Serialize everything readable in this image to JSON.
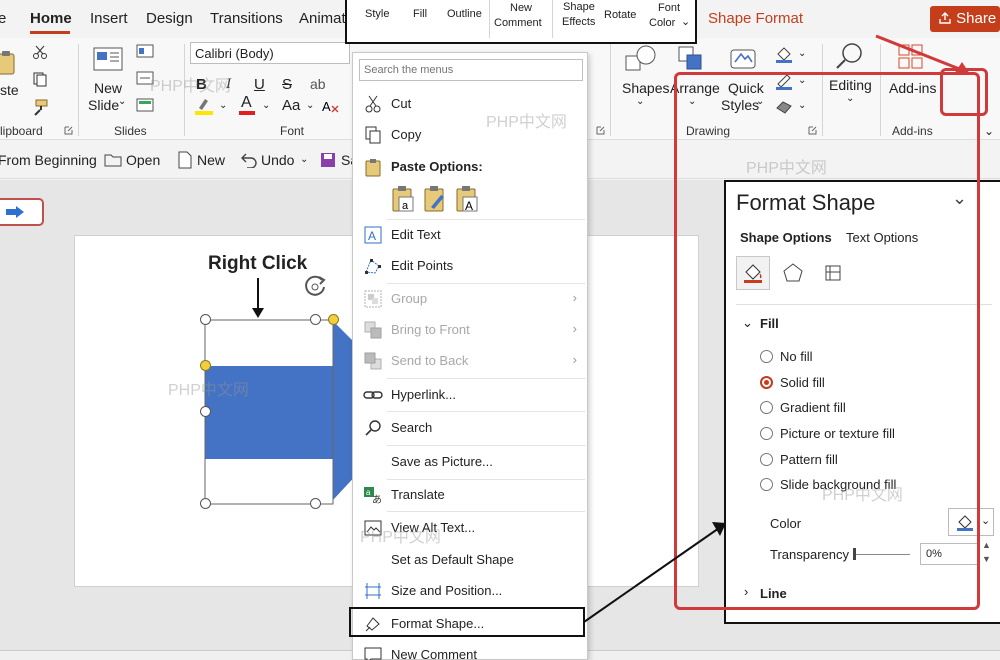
{
  "tabs": {
    "file_partial": "e",
    "home": "Home",
    "insert": "Insert",
    "design": "Design",
    "transitions": "Transitions",
    "animations_partial": "Animat",
    "shape_format": "Shape Format",
    "share": "Share"
  },
  "ribbon": {
    "paste_partial": "ste",
    "clipboard_partial": "lipboard",
    "new_slide_line1": "New",
    "new_slide_line2": "Slide",
    "slides_group": "Slides",
    "font_name": "Calibri (Body)",
    "font_group": "Font",
    "shapes": "Shapes",
    "arrange": "Arrange",
    "quick_styles_line1": "Quick",
    "quick_styles_line2": "Styles",
    "drawing_group": "Drawing",
    "editing": "Editing",
    "addins": "Add-ins",
    "addins_group": "Add-ins"
  },
  "qat": {
    "from_beginning": "From Beginning",
    "open": "Open",
    "new": "New",
    "undo": "Undo",
    "save_partial": "Sa"
  },
  "mini_toolbar": {
    "style": "Style",
    "fill": "Fill",
    "outline": "Outline",
    "new_comment_line1": "New",
    "new_comment_line2": "Comment",
    "shape_effects_line1": "Shape",
    "shape_effects_line2": "Effects",
    "rotate": "Rotate",
    "font_color_line1": "Font",
    "font_color_line2": "Color"
  },
  "context_menu": {
    "search_placeholder": "Search the menus",
    "cut": "Cut",
    "copy": "Copy",
    "paste_options": "Paste Options:",
    "edit_text": "Edit Text",
    "edit_points": "Edit Points",
    "group": "Group",
    "bring_to_front": "Bring to Front",
    "send_to_back": "Send to Back",
    "hyperlink": "Hyperlink...",
    "search": "Search",
    "save_as_picture": "Save as Picture...",
    "translate": "Translate",
    "view_alt_text": "View Alt Text...",
    "set_default_shape": "Set as Default Shape",
    "size_and_position": "Size and Position...",
    "format_shape": "Format Shape...",
    "new_comment": "New Comment"
  },
  "slide": {
    "annotation": "Right Click"
  },
  "format_pane": {
    "title": "Format Shape",
    "tab_shape_options": "Shape Options",
    "tab_text_options": "Text Options",
    "fill_section": "Fill",
    "fill_options": [
      "No fill",
      "Solid fill",
      "Gradient fill",
      "Picture or texture fill",
      "Pattern fill",
      "Slide background fill"
    ],
    "selected_fill": "Solid fill",
    "color_label": "Color",
    "transparency_label": "Transparency",
    "transparency_value": "0%",
    "line_section": "Line"
  },
  "watermark": "PHP中文网",
  "colors": {
    "accent": "#c43e1c",
    "shape_fill": "#4472c4",
    "highlight_box": "#d03a3a",
    "handle_yellow": "#f2d03b"
  }
}
